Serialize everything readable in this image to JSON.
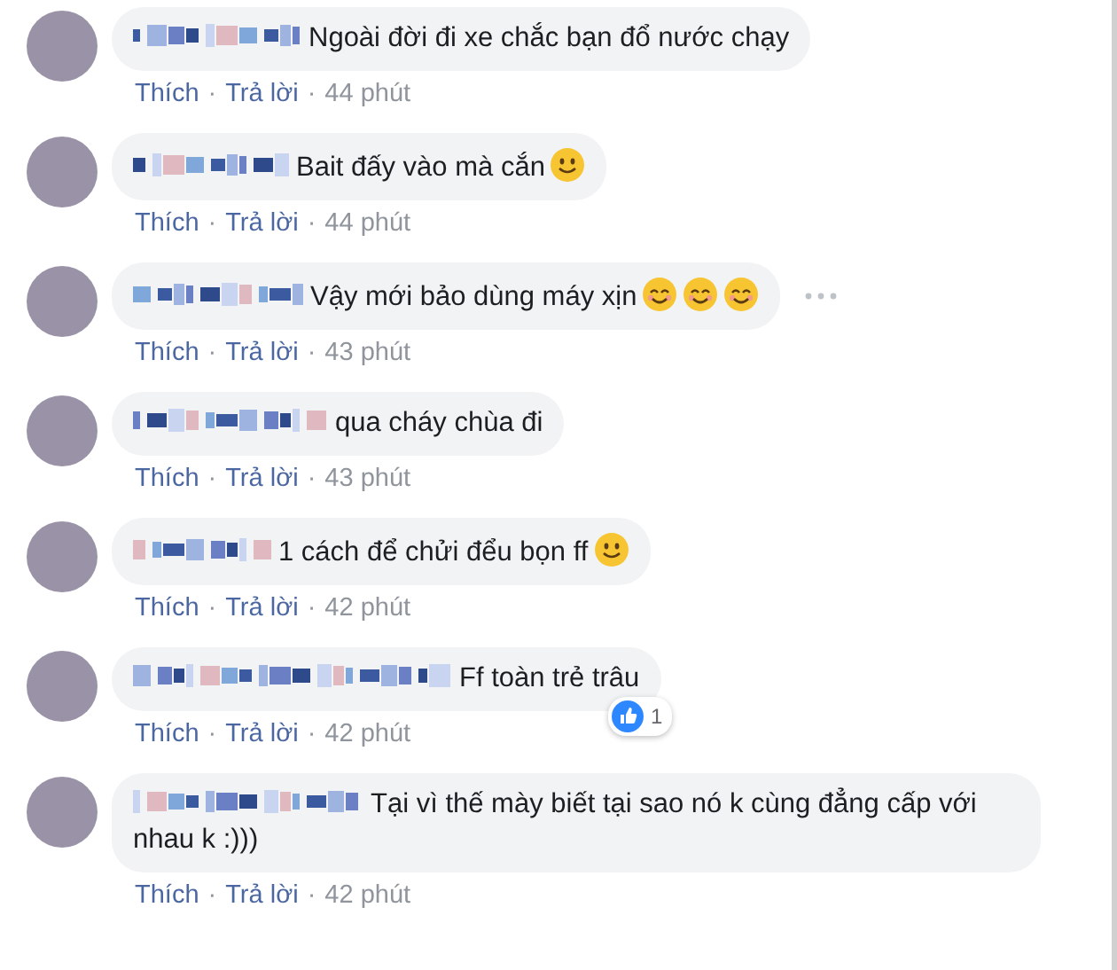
{
  "comments": [
    {
      "name_hidden": true,
      "text": "Ngoài đời đi xe chắc bạn đổ nước chạy",
      "actions": [
        {
          "kind": "link",
          "text": "Thích"
        },
        {
          "kind": "sep",
          "text": "·"
        },
        {
          "kind": "link",
          "text": "Trả lời"
        },
        {
          "kind": "sep",
          "text": "·"
        },
        {
          "kind": "time",
          "text": "44 phút"
        }
      ]
    },
    {
      "name_hidden": true,
      "text": "Bait đấy vào mà cắn",
      "emojis": [
        {
          "kind": "slight_smile"
        }
      ],
      "actions": [
        {
          "kind": "link",
          "text": "Thích"
        },
        {
          "kind": "sep",
          "text": "·"
        },
        {
          "kind": "link",
          "text": "Trả lời"
        },
        {
          "kind": "sep",
          "text": "·"
        },
        {
          "kind": "time",
          "text": "44 phút"
        }
      ]
    },
    {
      "name_hidden": true,
      "text": "Vậy mới bảo dùng máy xịn",
      "emojis": [
        {
          "kind": "smile"
        },
        {
          "kind": "smile"
        },
        {
          "kind": "smile"
        }
      ],
      "more_menu": true,
      "actions": [
        {
          "kind": "link",
          "text": "Thích"
        },
        {
          "kind": "sep",
          "text": "·"
        },
        {
          "kind": "link",
          "text": "Trả lời"
        },
        {
          "kind": "sep",
          "text": "·"
        },
        {
          "kind": "time",
          "text": "43 phút"
        }
      ]
    },
    {
      "name_hidden": true,
      "text": "qua cháy chùa đi",
      "actions": [
        {
          "kind": "link",
          "text": "Thích"
        },
        {
          "kind": "sep",
          "text": "·"
        },
        {
          "kind": "link",
          "text": "Trả lời"
        },
        {
          "kind": "sep",
          "text": "·"
        },
        {
          "kind": "time",
          "text": "43 phút"
        }
      ]
    },
    {
      "name_hidden": true,
      "text": "1 cách để chửi đểu bọn ff",
      "emojis": [
        {
          "kind": "slight_smile"
        }
      ],
      "actions": [
        {
          "kind": "link",
          "text": "Thích"
        },
        {
          "kind": "sep",
          "text": "·"
        },
        {
          "kind": "link",
          "text": "Trả lời"
        },
        {
          "kind": "sep",
          "text": "·"
        },
        {
          "kind": "time",
          "text": "42 phút"
        }
      ]
    },
    {
      "name_hidden": true,
      "text": "Ff toàn trẻ trâu",
      "reaction": {
        "count": "1"
      },
      "actions": [
        {
          "kind": "link",
          "text": "Thích"
        },
        {
          "kind": "sep",
          "text": "·"
        },
        {
          "kind": "link",
          "text": "Trả lời"
        },
        {
          "kind": "sep",
          "text": "·"
        },
        {
          "kind": "time",
          "text": "42 phút"
        }
      ]
    },
    {
      "name_hidden": true,
      "text": "Tại vì thế mày biết tại sao nó k cùng đẳng cấp với nhau k :)))",
      "actions": [
        {
          "kind": "link",
          "text": "Thích"
        },
        {
          "kind": "sep",
          "text": "·"
        },
        {
          "kind": "link",
          "text": "Trả lời"
        },
        {
          "kind": "sep",
          "text": "·"
        },
        {
          "kind": "time",
          "text": "42 phút"
        }
      ]
    }
  ]
}
